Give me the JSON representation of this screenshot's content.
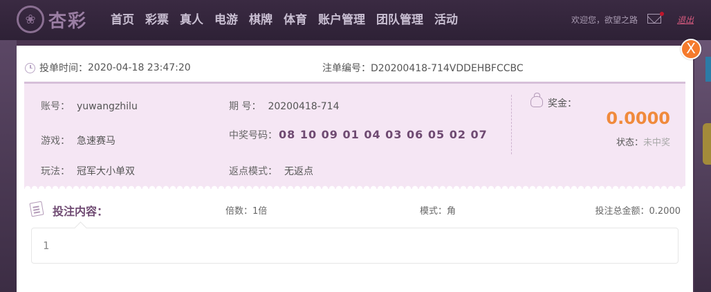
{
  "nav": {
    "logo_text": "杏彩",
    "items": [
      "首页",
      "彩票",
      "真人",
      "电游",
      "棋牌",
      "体育",
      "账户管理",
      "团队管理",
      "活动"
    ],
    "welcome": "欢迎您，欲望之路",
    "logout": "退出"
  },
  "modal": {
    "close_label": "X",
    "bet_time_label": "投单时间：",
    "bet_time": "2020-04-18 23:47:20",
    "order_label": "注单编号：",
    "order_id": "D20200418-714VDDEHBFCCBC",
    "ticket": {
      "account_label": "账号：",
      "account": "yuwangzhilu",
      "issue_label": "期 号：",
      "issue": "20200418-714",
      "game_label": "游戏：",
      "game": "急速赛马",
      "winning_label": "中奖号码：",
      "winning_numbers": "08 10 09 01 04 03 06 05 02 07",
      "play_label": "玩法：",
      "play": "冠军大小单双",
      "rebate_label": "返点模式：",
      "rebate": "无返点",
      "prize_label": "奖金：",
      "prize": "0.0000",
      "status_label": "状态：",
      "status": "未中奖"
    },
    "content": {
      "title": "投注内容：",
      "multiple": "倍数：1倍",
      "mode": "模式：角",
      "total": "投注总金额：0.2000",
      "body": "1"
    }
  },
  "colors": {
    "accent": "#f57a2c",
    "prize": "#f08a3c",
    "ticket_bg": "#f5e6f4",
    "title": "#6f4a72"
  },
  "icons": [
    "clock-icon",
    "money-bag-icon",
    "scroll-icon",
    "mail-icon",
    "close-icon"
  ]
}
